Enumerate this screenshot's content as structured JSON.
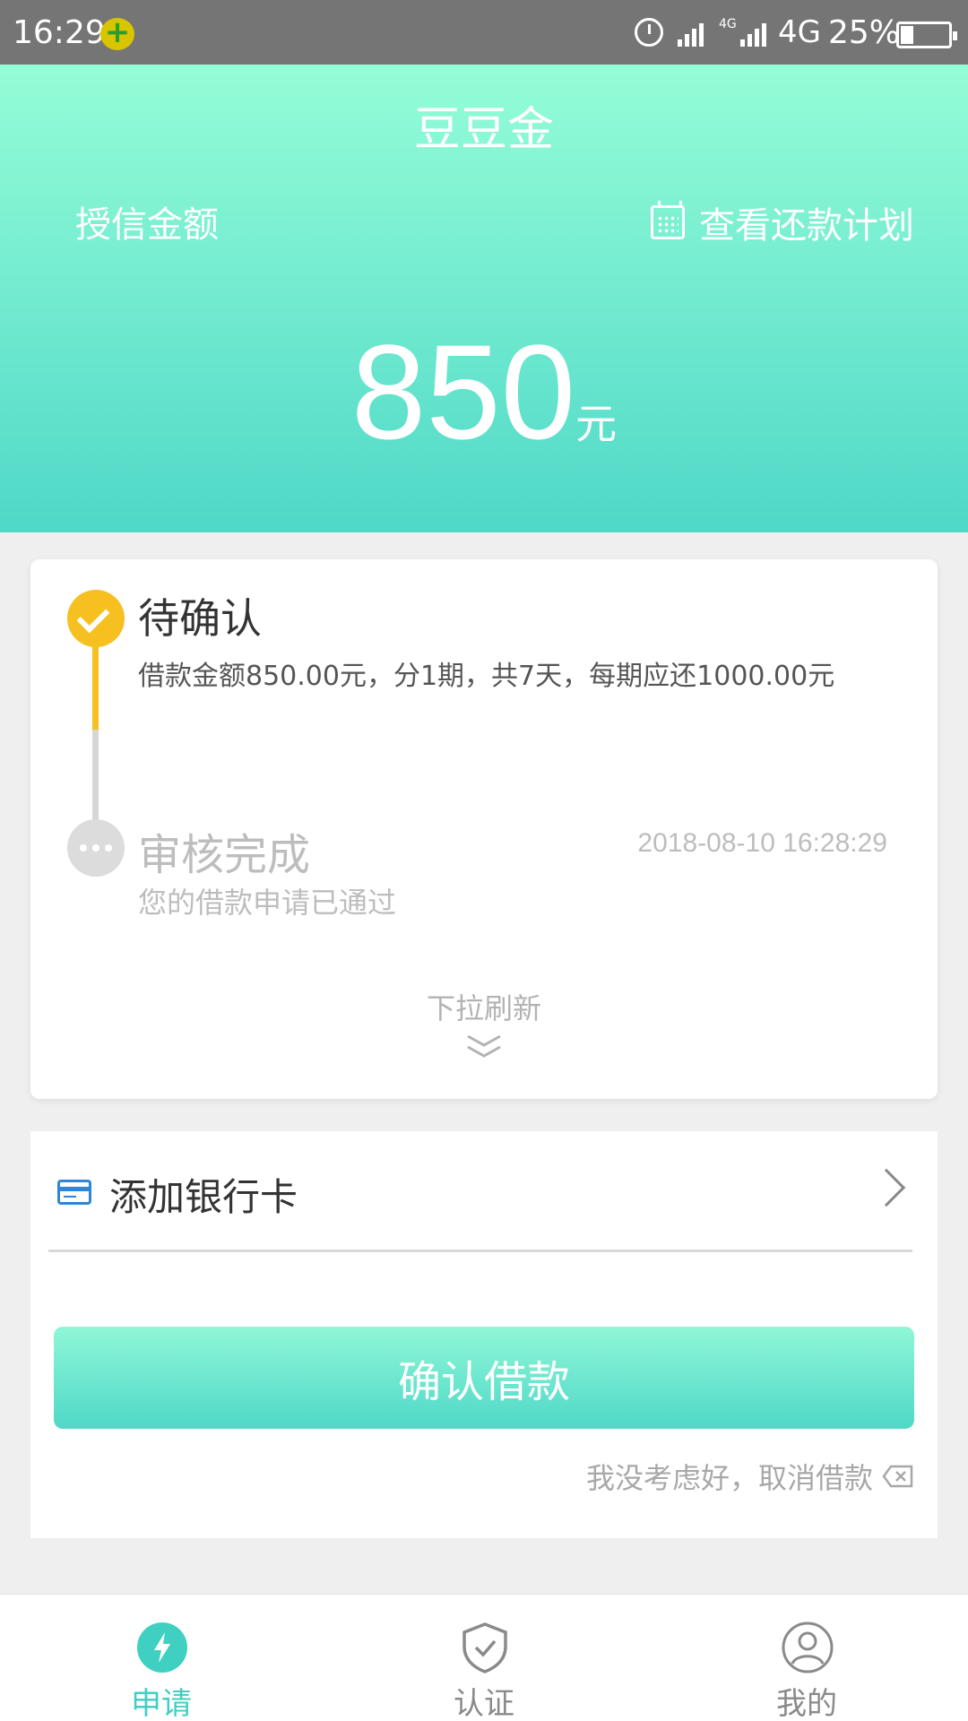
{
  "status_bar": {
    "time": "16:29",
    "network": "4G",
    "battery": "25%",
    "net_small": "4G"
  },
  "header": {
    "title": "豆豆金",
    "credit_label": "授信金额",
    "plan_link": "查看还款计划",
    "amount": "850",
    "amount_unit": "元"
  },
  "progress": {
    "step1": {
      "title": "待确认",
      "desc": "借款金额850.00元，分1期，共7天，每期应还1000.00元",
      "state": "current"
    },
    "step2": {
      "title": "审核完成",
      "time": "2018-08-10 16:28:29",
      "desc": "您的借款申请已通过",
      "state": "done"
    },
    "pull_hint": "下拉刷新"
  },
  "bank": {
    "label": "添加银行卡"
  },
  "actions": {
    "confirm": "确认借款",
    "cancel": "我没考虑好，取消借款"
  },
  "nav": {
    "items": [
      {
        "label": "申请",
        "icon": "lightning-icon",
        "active": true
      },
      {
        "label": "认证",
        "icon": "shield-check-icon",
        "active": false
      },
      {
        "label": "我的",
        "icon": "user-icon",
        "active": false
      }
    ]
  },
  "colors": {
    "accent": "#4fd8c8",
    "accent_light": "#95fdd7",
    "pending": "#f5c020",
    "link_blue": "#2f86d6"
  }
}
